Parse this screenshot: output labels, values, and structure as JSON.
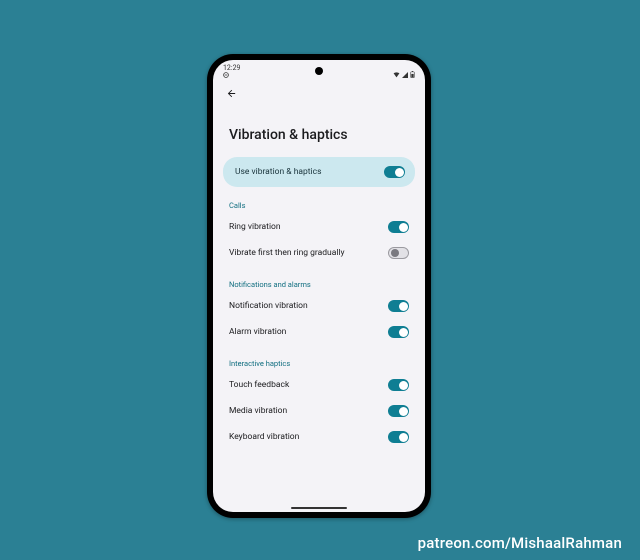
{
  "statusbar": {
    "time": "12:29"
  },
  "page": {
    "title": "Vibration & haptics"
  },
  "master": {
    "label": "Use vibration & haptics",
    "on": true
  },
  "sections": {
    "calls": {
      "header": "Calls",
      "ring": {
        "label": "Ring vibration",
        "on": true
      },
      "gradual": {
        "label": "Vibrate first then ring gradually",
        "on": false
      }
    },
    "notif": {
      "header": "Notifications and alarms",
      "notification": {
        "label": "Notification vibration",
        "on": true
      },
      "alarm": {
        "label": "Alarm vibration",
        "on": true
      }
    },
    "interactive": {
      "header": "Interactive haptics",
      "touch": {
        "label": "Touch feedback",
        "on": true
      },
      "media": {
        "label": "Media vibration",
        "on": true
      },
      "keyboard": {
        "label": "Keyboard vibration",
        "on": true
      }
    }
  },
  "credit": "patreon.com/MishaalRahman"
}
